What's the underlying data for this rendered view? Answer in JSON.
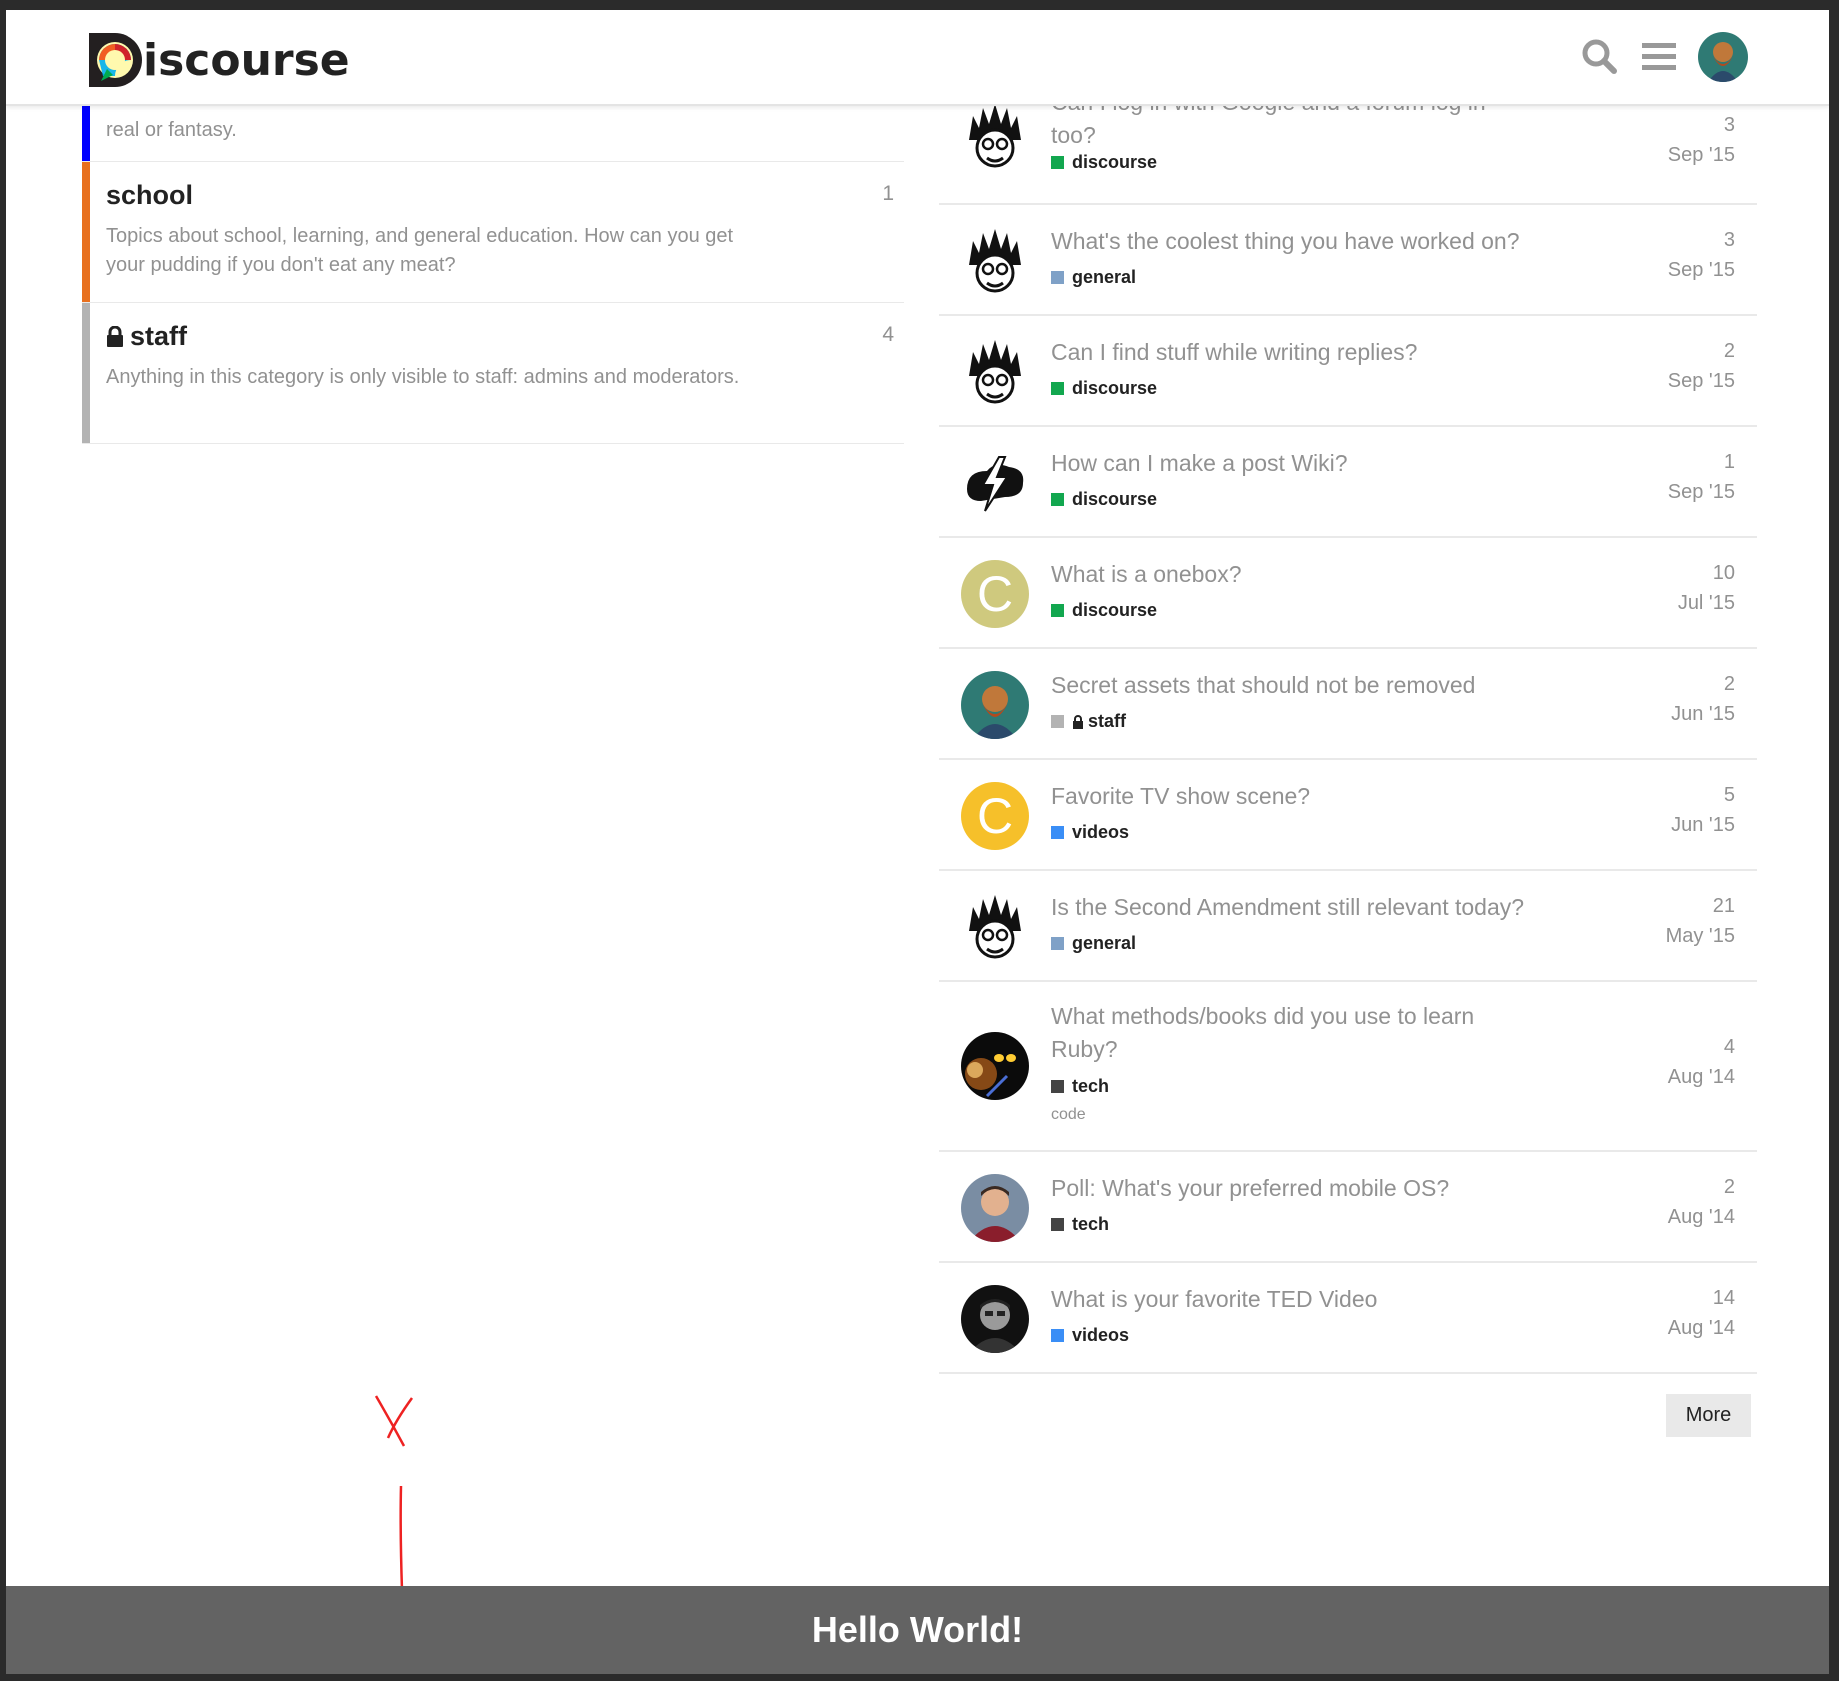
{
  "header": {
    "logo_text": "iscourse",
    "search_icon": "search-icon",
    "menu_icon": "hamburger-menu-icon",
    "avatar": "user-avatar"
  },
  "categories": [
    {
      "name": "",
      "description": "real or fantasy.",
      "count": "",
      "color": "#0000ff"
    },
    {
      "name": "school",
      "description": "Topics about school, learning, and general education. How can you get your pudding if you don't eat any meat?",
      "count": "1",
      "color": "#e8701e"
    },
    {
      "name": "staff",
      "description": "Anything in this category is only visible to staff: admins and moderators.",
      "count": "4",
      "color": "#b3b3b3",
      "locked": true
    }
  ],
  "topics": [
    {
      "title": "Can I log in with Google and a forum log in too?",
      "category": "discourse",
      "cat_color": "#12a74f",
      "posts": "3",
      "date": "Sep '15",
      "avatar": "spiky-hair-avatar"
    },
    {
      "title": "What's the coolest thing you have worked on?",
      "category": "general",
      "cat_color": "#7fa1c7",
      "posts": "3",
      "date": "Sep '15",
      "avatar": "spiky-hair-avatar"
    },
    {
      "title": "Can I find stuff while writing replies?",
      "category": "discourse",
      "cat_color": "#12a74f",
      "posts": "2",
      "date": "Sep '15",
      "avatar": "spiky-hair-avatar"
    },
    {
      "title": "How can I make a post Wiki?",
      "category": "discourse",
      "cat_color": "#12a74f",
      "posts": "1",
      "date": "Sep '15",
      "avatar": "bolt-logo-avatar"
    },
    {
      "title": "What is a onebox?",
      "category": "discourse",
      "cat_color": "#12a74f",
      "posts": "10",
      "date": "Jul '15",
      "avatar": "letter-c-avatar",
      "letter": "C",
      "letter_bg": "#cfc97e"
    },
    {
      "title": "Secret assets that should not be removed",
      "category": "staff",
      "cat_color": "#b3b3b3",
      "posts": "2",
      "date": "Jun '15",
      "avatar": "portrait-avatar",
      "locked": true
    },
    {
      "title": "Favorite TV show scene?",
      "category": "videos",
      "cat_color": "#3a8ef6",
      "posts": "5",
      "date": "Jun '15",
      "avatar": "letter-c-avatar",
      "letter": "C",
      "letter_bg": "#f6c02a"
    },
    {
      "title": "Is the Second Amendment still relevant today?",
      "category": "general",
      "cat_color": "#7fa1c7",
      "posts": "21",
      "date": "May '15",
      "avatar": "spiky-hair-avatar"
    },
    {
      "title": "What methods/books did you use to learn Ruby?",
      "category": "tech",
      "cat_color": "#444444",
      "posts": "4",
      "date": "Aug '14",
      "avatar": "dark-figure-avatar",
      "tag": "code"
    },
    {
      "title": "Poll: What's your preferred mobile OS?",
      "category": "tech",
      "cat_color": "#444444",
      "posts": "2",
      "date": "Aug '14",
      "avatar": "man-photo-avatar"
    },
    {
      "title": "What is your favorite TED Video",
      "category": "videos",
      "cat_color": "#3a8ef6",
      "posts": "14",
      "date": "Aug '14",
      "avatar": "man-bw-photo-avatar"
    }
  ],
  "more_label": "More",
  "banner_text": "Hello World!"
}
